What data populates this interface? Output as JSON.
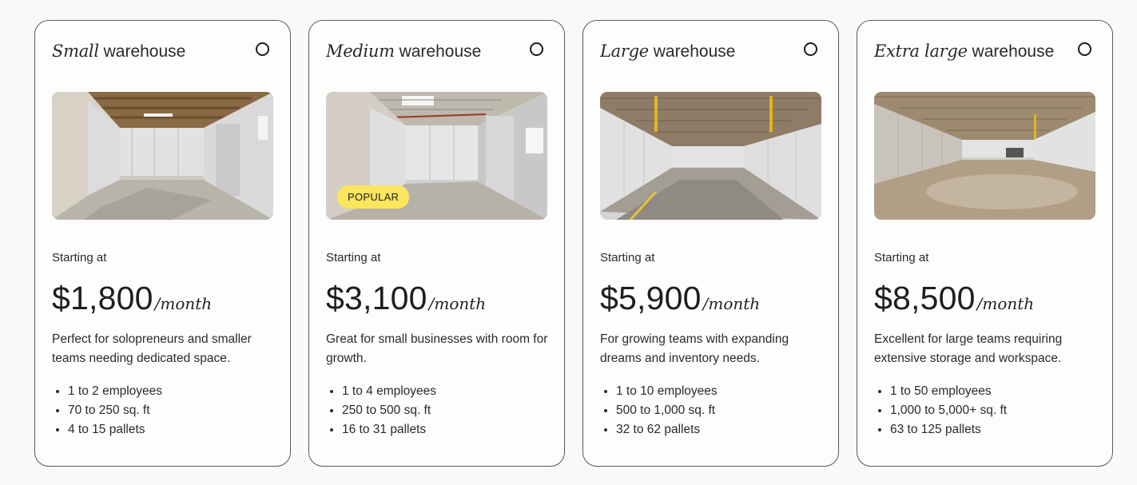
{
  "plans": [
    {
      "size_word": "Small",
      "suffix": "warehouse",
      "badge": "",
      "starting_label": "Starting at",
      "price": "$1,800",
      "period": "/month",
      "description": "Perfect for solopreneurs and smaller teams needing dedicated space.",
      "features": [
        "1 to 2 employees",
        "70 to 250 sq. ft",
        "4 to 15 pallets"
      ],
      "selected": false
    },
    {
      "size_word": "Medium",
      "suffix": "warehouse",
      "badge": "POPULAR",
      "starting_label": "Starting at",
      "price": "$3,100",
      "period": "/month",
      "description": "Great for small businesses with room for growth.",
      "features": [
        "1 to 4 employees",
        "250 to 500 sq. ft",
        "16 to 31 pallets"
      ],
      "selected": false
    },
    {
      "size_word": "Large",
      "suffix": "warehouse",
      "badge": "",
      "starting_label": "Starting at",
      "price": "$5,900",
      "period": "/month",
      "description": "For growing teams with expanding dreams and inventory needs.",
      "features": [
        "1 to 10 employees",
        "500 to 1,000 sq. ft",
        "32 to 62 pallets"
      ],
      "selected": false
    },
    {
      "size_word": "Extra large",
      "suffix": "warehouse",
      "badge": "",
      "starting_label": "Starting at",
      "price": "$8,500",
      "period": "/month",
      "description": "Excellent for large teams requiring extensive storage and workspace.",
      "features": [
        "1 to 50 employees",
        "1,000 to 5,000+ sq. ft",
        "63 to 125 pallets"
      ],
      "selected": false
    }
  ],
  "colors": {
    "badge_bg": "#fbe55e",
    "card_border": "#5a5a5a",
    "text": "#222222"
  }
}
